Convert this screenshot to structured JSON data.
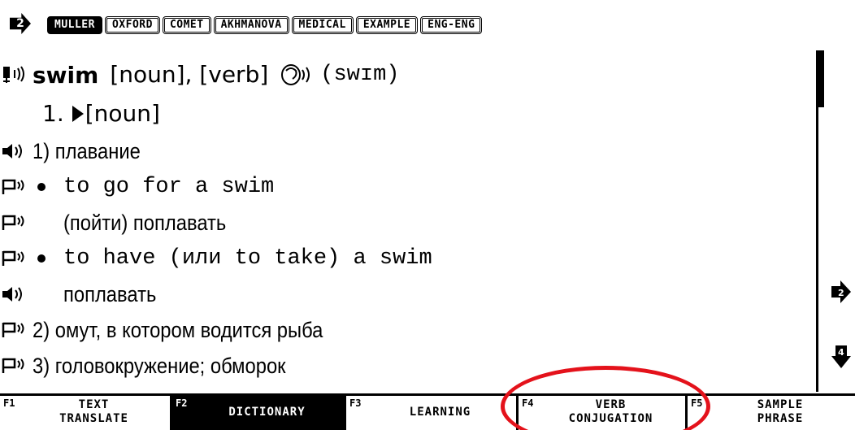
{
  "dictionaries": {
    "nav_icon": "right-arrow-icon",
    "nav_badge": "2",
    "tabs": [
      "MULLER",
      "OXFORD",
      "COMET",
      "AKHMANOVA",
      "MEDICAL",
      "EXAMPLE",
      "ENG-ENG"
    ],
    "active_tab": "MULLER"
  },
  "entry": {
    "headword": "swim",
    "parts_of_speech": "[noun], [verb]",
    "transcription": "(swɪm)",
    "section": "1.",
    "section_label": "[noun]",
    "lines": [
      {
        "text": "1) плавание",
        "icon": "speaker-icon",
        "lang": "ru"
      },
      {
        "text": "to go for a swim",
        "icon": "flag-speaker-icon",
        "lang": "en",
        "bullet": true
      },
      {
        "text": "(пойти) поплавать",
        "icon": "flag-speaker-icon",
        "lang": "ru"
      },
      {
        "text": "to have (или to take) a swim",
        "icon": "flag-speaker-icon",
        "lang": "en",
        "bullet": true
      },
      {
        "text": "поплавать",
        "icon": "speaker-icon",
        "lang": "ru"
      },
      {
        "text": "2) омут, в котором водится рыба",
        "icon": "flag-speaker-icon",
        "lang": "ru"
      },
      {
        "text": "3) головокружение; обморок",
        "icon": "flag-speaker-icon",
        "lang": "ru"
      }
    ]
  },
  "side": {
    "right_badge": "2",
    "down_badge": "4"
  },
  "function_keys": [
    {
      "key": "F1",
      "label_lines": [
        "TEXT",
        "TRANSLATE"
      ],
      "active": false
    },
    {
      "key": "F2",
      "label_lines": [
        "DICTIONARY"
      ],
      "active": true
    },
    {
      "key": "F3",
      "label_lines": [
        "LEARNING"
      ],
      "active": false
    },
    {
      "key": "F4",
      "label_lines": [
        "VERB",
        "CONJUGATION"
      ],
      "active": false
    },
    {
      "key": "F5",
      "label_lines": [
        "SAMPLE",
        "PHRASE"
      ],
      "active": false
    }
  ],
  "highlight_color": "#e4121b"
}
